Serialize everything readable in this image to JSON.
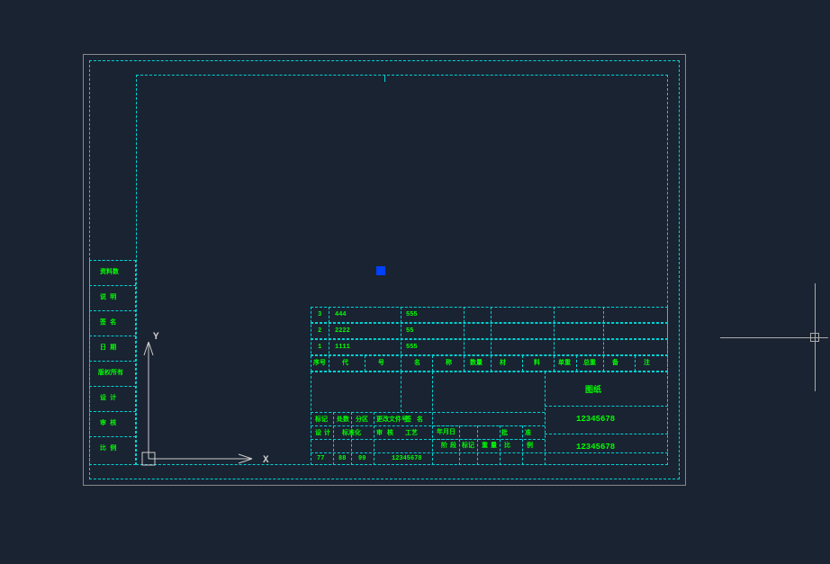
{
  "colors": {
    "background": "#1a2332",
    "dashline": "#00d4d4",
    "text": "#00ff00",
    "grip": "#0040ff",
    "cursor": "#aaaaaa",
    "border": "#888888"
  },
  "ucs": {
    "x_label": "X",
    "y_label": "Y"
  },
  "side_labels": [
    "资料数",
    "说 明",
    "签 名",
    "日 期",
    "版权所有",
    "设 计",
    "审 核",
    "比 例"
  ],
  "title_block": {
    "big_number_1": "12345678",
    "big_number_2": "12345678",
    "center_label": "图纸"
  },
  "upper_rows": {
    "row1": {
      "n": "3",
      "col1": "444",
      "col2": "555"
    },
    "row2": {
      "n": "2",
      "col1": "2222",
      "col2": "55"
    },
    "row3": {
      "n": "1",
      "col1": "1111",
      "col2": "555"
    },
    "headers": [
      "序号",
      "代",
      "号",
      "名",
      "称",
      "数量",
      "材",
      "料",
      "单重",
      "总重",
      "备",
      "注"
    ]
  },
  "lower_rows": {
    "r1": [
      "标记",
      "处数",
      "分区",
      "更改文件号",
      "签",
      "名",
      "年月日"
    ],
    "r2": [
      "设",
      "计",
      "标准化",
      "审",
      "核",
      "工艺",
      "批",
      "准"
    ],
    "r3": [
      "77",
      "88",
      "99",
      "12345678",
      "阶",
      "段",
      "标记",
      "重",
      "量",
      "比",
      "例"
    ]
  }
}
